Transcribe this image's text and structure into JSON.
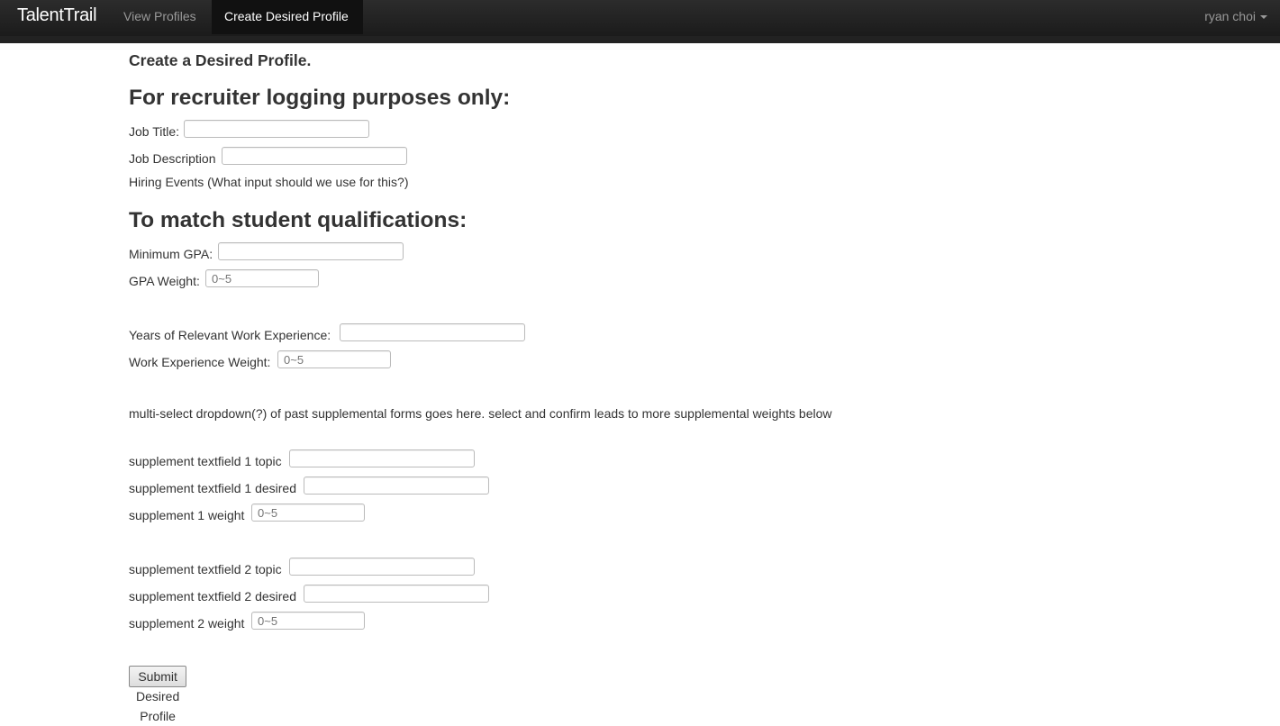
{
  "navbar": {
    "brand": "TalentTrail",
    "links": [
      {
        "label": "View Profiles",
        "active": false
      },
      {
        "label": "Create Desired Profile",
        "active": true
      }
    ],
    "user": "ryan choi"
  },
  "page": {
    "title": "Create a Desired Profile."
  },
  "recruiter_section": {
    "heading": "For recruiter logging purposes only:",
    "job_title_label": "Job Title:",
    "job_title_value": "",
    "job_description_label": "Job Description",
    "job_description_value": "",
    "hiring_events_label": "Hiring Events (What input should we use for this?)"
  },
  "qualifications_section": {
    "heading": "To match student qualifications:",
    "min_gpa_label": "Minimum GPA:",
    "min_gpa_value": "",
    "gpa_weight_label": "GPA Weight:",
    "gpa_weight_placeholder": "0~5",
    "work_years_label": "Years of Relevant Work Experience:",
    "work_years_value": "",
    "work_weight_label": "Work Experience Weight:",
    "work_weight_placeholder": "0~5",
    "supplemental_note": "multi-select dropdown(?) of past supplemental forms goes here. select and confirm leads to more supplemental weights below"
  },
  "supplements": [
    {
      "topic_label": "supplement textfield 1 topic",
      "desired_label": "supplement textfield 1 desired",
      "weight_label": "supplement 1 weight",
      "weight_placeholder": "0~5"
    },
    {
      "topic_label": "supplement textfield 2 topic",
      "desired_label": "supplement textfield 2 desired",
      "weight_label": "supplement 2 weight",
      "weight_placeholder": "0~5"
    }
  ],
  "submit_label": "Submit Desired Profile",
  "colors": {
    "navbar_bg": "#1b1b1b",
    "active_tab_bg": "#111111",
    "nav_text": "#999999",
    "body_text": "#333333"
  }
}
